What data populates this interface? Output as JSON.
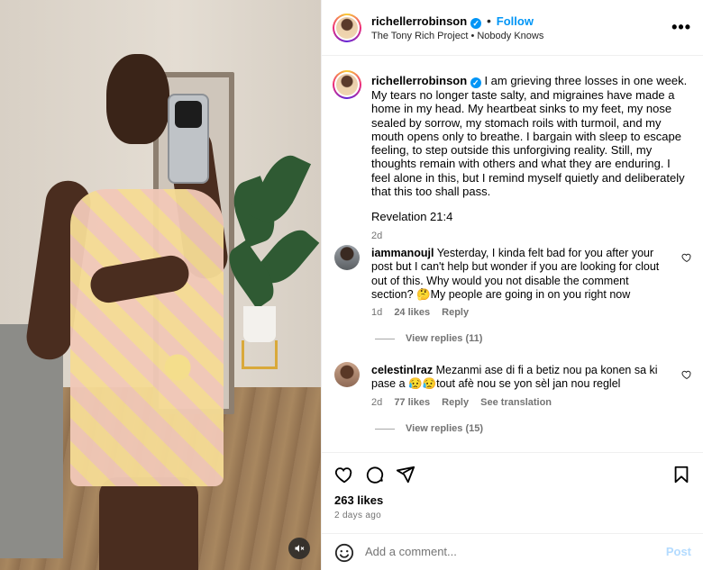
{
  "post": {
    "username": "richellerrobinson",
    "follow_label": "Follow",
    "dot": "•",
    "audio": "The Tony Rich Project • Nobody Knows",
    "more_label": "•••"
  },
  "caption": {
    "username": "richellerrobinson",
    "text": "I am grieving three losses in one week. My tears no longer taste salty, and migraines have made a home in my head. My heartbeat sinks to my feet, my nose sealed by sorrow, my stomach roils with turmoil, and my mouth opens only to breathe. I bargain with sleep to escape feeling, to step outside this unforgiving reality. Still, my thoughts remain with others and what they are enduring. I feel alone in this, but I remind myself quietly and deliberately that this too shall pass.",
    "verse": "Revelation 21:4",
    "time": "2d"
  },
  "comments": [
    {
      "username": "iammanoujl",
      "text": "Yesterday, I kinda felt bad for you after your post but I can't help but wonder if you are looking for clout out of this. Why would you not disable the comment section? 🤔My people are going in on you right now",
      "time": "1d",
      "likes": "24 likes",
      "reply": "Reply",
      "view_replies": "View replies (11)"
    },
    {
      "username": "celestinlraz",
      "text": "Mezanmi ase di fi a betiz nou pa konen sa ki pase a 😥😥tout afè nou se yon sèl jan nou reglel",
      "time": "2d",
      "likes": "77 likes",
      "reply": "Reply",
      "translate": "See translation",
      "view_replies": "View replies (15)"
    }
  ],
  "stats": {
    "likes": "263 likes",
    "ago": "2 days ago"
  },
  "composer": {
    "placeholder": "Add a comment...",
    "post_label": "Post"
  },
  "icons": {
    "like": "heart-icon",
    "comment": "comment-icon",
    "share": "share-icon",
    "save": "bookmark-icon",
    "mute": "speaker-muted-icon",
    "emoji": "emoji-icon"
  },
  "colors": {
    "accent": "#0095f6",
    "muted": "#737373",
    "post_disabled": "#b3dbff"
  }
}
